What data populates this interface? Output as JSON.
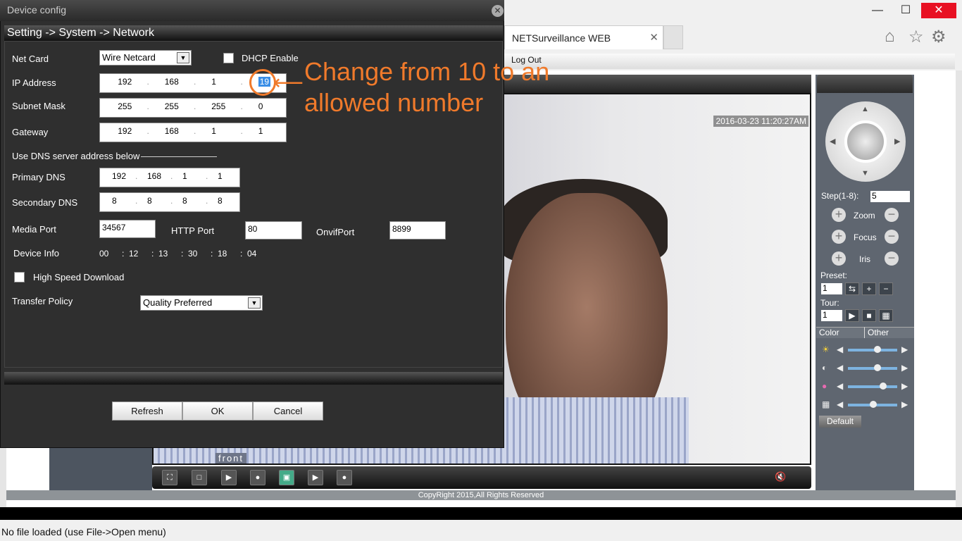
{
  "browser": {
    "tab_title": "NETSurveillance WEB",
    "close": "✕",
    "minimize": "—",
    "maximize": "☐",
    "window_close": "✕",
    "home_icon": "⌂",
    "star_icon": "☆",
    "gear_icon": "⚙"
  },
  "web": {
    "logout": "Log Out",
    "timestamp": "2016-03-23 11:20:27AM",
    "channel_label": "front",
    "copyright": "CopyRight 2015,All Rights Reserved",
    "toolbar_icons": [
      "fullscreen-icon",
      "single-view-icon",
      "start-record-icon",
      "stop-record-icon",
      "snapshot-icon",
      "start-playback-icon",
      "stop-playback-icon"
    ],
    "mute_icon": "🔇"
  },
  "ptz": {
    "step_label": "Step(1-8):",
    "step_value": "5",
    "zoom": "Zoom",
    "focus": "Focus",
    "iris": "Iris",
    "preset_label": "Preset:",
    "preset_value": "1",
    "tour_label": "Tour:",
    "tour_value": "1",
    "tabs": [
      "Color",
      "Other"
    ],
    "default": "Default",
    "sliders": [
      {
        "name": "brightness",
        "value": 0.6
      },
      {
        "name": "contrast",
        "value": 0.6
      },
      {
        "name": "saturation",
        "value": 0.72
      },
      {
        "name": "hue",
        "value": 0.52
      }
    ]
  },
  "dialog": {
    "title": "Device config",
    "breadcrumb": "Setting -> System -> Network",
    "net_card_label": "Net Card",
    "net_card_value": "Wire Netcard",
    "dhcp_label": "DHCP Enable",
    "dhcp_checked": false,
    "ip_label": "IP Address",
    "ip": [
      "192",
      "168",
      "1",
      "19"
    ],
    "mask_label": "Subnet Mask",
    "mask": [
      "255",
      "255",
      "255",
      "0"
    ],
    "gateway_label": "Gateway",
    "gateway": [
      "192",
      "168",
      "1",
      "1"
    ],
    "dns_heading": "Use DNS server address below",
    "pdns_label": "Primary DNS",
    "pdns": [
      "192",
      "168",
      "1",
      "1"
    ],
    "sdns_label": "Secondary DNS",
    "sdns": [
      "8",
      "8",
      "8",
      "8"
    ],
    "media_port_label": "Media Port",
    "media_port": "34567",
    "http_port_label": "HTTP Port",
    "http_port": "80",
    "onvif_label": "OnvifPort",
    "onvif_port": "8899",
    "device_info_label": "Device Info",
    "mac": [
      "00",
      "12",
      "13",
      "30",
      "18",
      "04"
    ],
    "hsd_label": "High Speed Download",
    "hsd_checked": false,
    "transfer_label": "Transfer Policy",
    "transfer_value": "Quality Preferred",
    "refresh": "Refresh",
    "ok": "OK",
    "cancel": "Cancel"
  },
  "annotation": {
    "line1": "Change from 10 to an",
    "line2": "allowed number",
    "color": "#f07a2b"
  },
  "status_bar": "No file loaded (use File->Open menu)"
}
